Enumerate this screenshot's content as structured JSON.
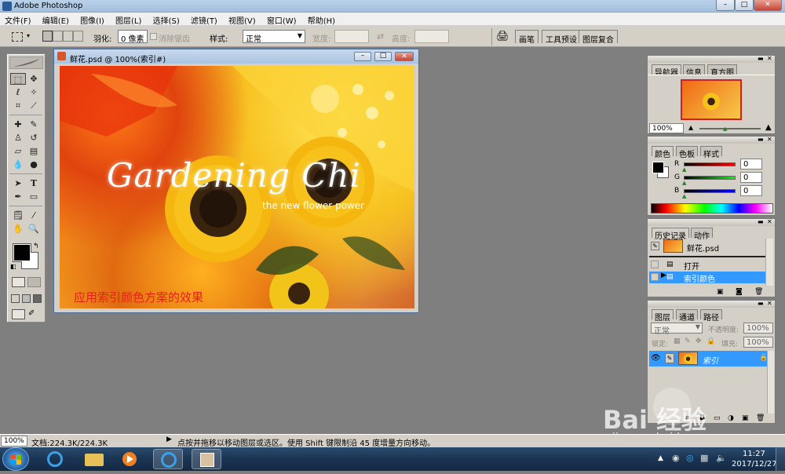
{
  "app": {
    "title": "Adobe Photoshop"
  },
  "menu": [
    "文件(F)",
    "编辑(E)",
    "图像(I)",
    "图层(L)",
    "选择(S)",
    "滤镜(T)",
    "视图(V)",
    "窗口(W)",
    "帮助(H)"
  ],
  "options": {
    "feather_label": "羽化:",
    "feather_value": "0 像素",
    "antialias_label": "消除锯齿",
    "style_label": "样式:",
    "style_value": "正常",
    "width_label": "宽度:",
    "height_label": "高度:",
    "palette_tabs": [
      "画笔",
      "工具预设",
      "图层复合"
    ]
  },
  "document": {
    "title": "鲜花.psd @ 100%(索引#)",
    "canvas_heading": "Gardening Chi",
    "canvas_subheading": "the new flower power",
    "canvas_caption": "应用索引颜色方案的效果"
  },
  "navigator": {
    "tabs": [
      "导航器",
      "信息",
      "直方图"
    ],
    "zoom": "100%"
  },
  "color_panel": {
    "tabs": [
      "颜色",
      "色板",
      "样式"
    ],
    "channels": [
      {
        "label": "R",
        "value": "0",
        "color": "#c00000"
      },
      {
        "label": "G",
        "value": "0",
        "color": "#00a000"
      },
      {
        "label": "B",
        "value": "0",
        "color": "#0000c0"
      }
    ]
  },
  "history_panel": {
    "tabs": [
      "历史记录",
      "动作"
    ],
    "snapshot": "鲜花.psd",
    "items": [
      "打开",
      "索引颜色"
    ]
  },
  "layers_panel": {
    "tabs": [
      "图层",
      "通道",
      "路径"
    ],
    "blend_mode": "正常",
    "opacity_label": "不透明度:",
    "opacity_value": "100%",
    "lock_label": "锁定:",
    "fill_label": "填充:",
    "fill_value": "100%",
    "layer_name": "索引"
  },
  "statusbar": {
    "zoom": "100%",
    "doc_info": "文档:224.3K/224.3K",
    "hint": "点按并拖移以移动图层或选区。使用 Shift 键限制沿 45 度增量方向移动。"
  },
  "taskbar": {
    "time": "11:27",
    "date": "2017/12/27"
  },
  "watermark": {
    "brand": "Bai 经验",
    "url": "jingyan.baidu.com"
  }
}
